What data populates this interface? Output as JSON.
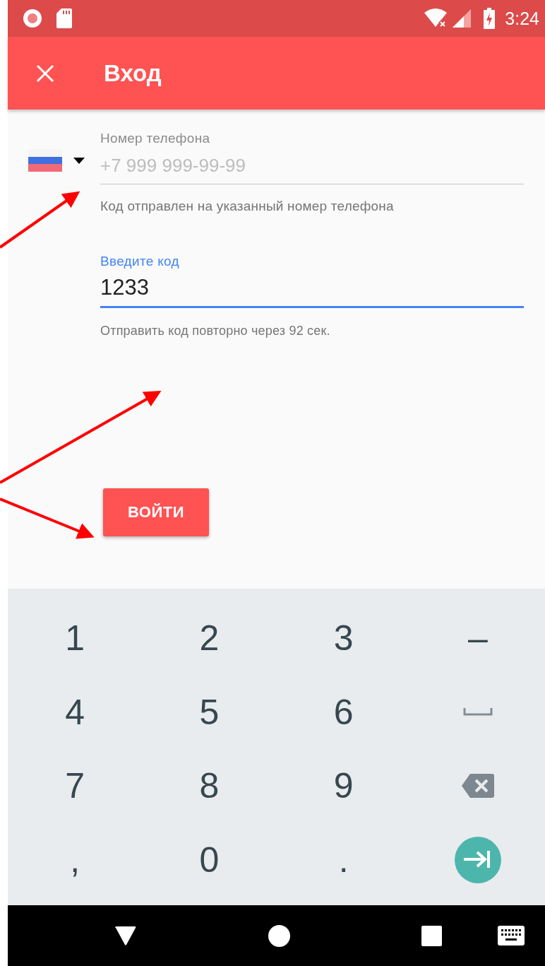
{
  "status_bar": {
    "time": "3:24"
  },
  "app_bar": {
    "title": "Вход"
  },
  "phone": {
    "label": "Номер телефона",
    "placeholder": "+7 999 999-99-99",
    "helper": "Код отправлен на указанный номер телефона",
    "focused": false
  },
  "code": {
    "label": "Введите код",
    "value": "1233",
    "helper": "Отправить код повторно через 92 сек.",
    "focused": true
  },
  "submit_button": {
    "label": "ВОЙТИ"
  },
  "keyboard": {
    "keys": [
      {
        "kind": "char",
        "label": "1"
      },
      {
        "kind": "char",
        "label": "2"
      },
      {
        "kind": "char",
        "label": "3"
      },
      {
        "kind": "char",
        "label": "–"
      },
      {
        "kind": "char",
        "label": "4"
      },
      {
        "kind": "char",
        "label": "5"
      },
      {
        "kind": "char",
        "label": "6"
      },
      {
        "kind": "space"
      },
      {
        "kind": "char",
        "label": "7"
      },
      {
        "kind": "char",
        "label": "8"
      },
      {
        "kind": "char",
        "label": "9"
      },
      {
        "kind": "backspace"
      },
      {
        "kind": "char",
        "label": ","
      },
      {
        "kind": "char",
        "label": "0"
      },
      {
        "kind": "char",
        "label": "."
      },
      {
        "kind": "next"
      }
    ]
  }
}
